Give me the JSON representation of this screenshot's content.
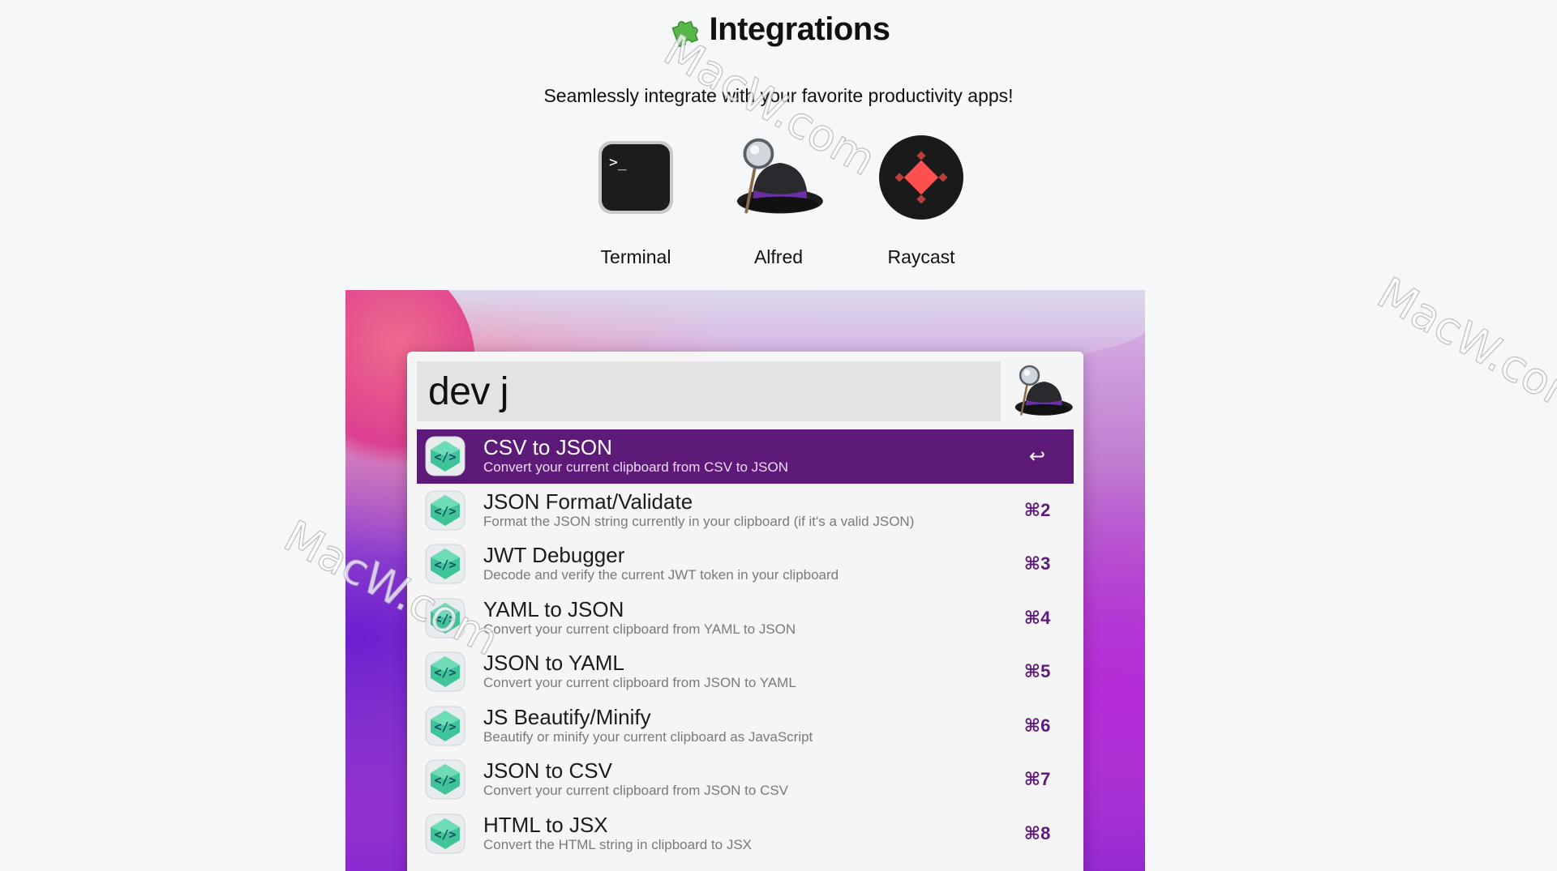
{
  "header": {
    "title": "Integrations",
    "subtitle": "Seamlessly integrate with your favorite productivity apps!",
    "icon": "puzzle-icon"
  },
  "apps": [
    {
      "label": "Terminal",
      "icon": "terminal-icon"
    },
    {
      "label": "Alfred",
      "icon": "alfred-hat-icon"
    },
    {
      "label": "Raycast",
      "icon": "raycast-icon"
    }
  ],
  "alfred": {
    "query": "dev j",
    "results": [
      {
        "title": "CSV to JSON",
        "subtitle": "Convert your current clipboard from CSV to JSON",
        "shortcut": "↩",
        "selected": true
      },
      {
        "title": "JSON Format/Validate",
        "subtitle": "Format the JSON string currently in your clipboard (if it's a valid JSON)",
        "shortcut": "⌘2"
      },
      {
        "title": "JWT Debugger",
        "subtitle": "Decode and verify the current JWT token in your clipboard",
        "shortcut": "⌘3"
      },
      {
        "title": "YAML to JSON",
        "subtitle": "Convert your current clipboard from YAML to JSON",
        "shortcut": "⌘4"
      },
      {
        "title": "JSON to YAML",
        "subtitle": "Convert your current clipboard from JSON to YAML",
        "shortcut": "⌘5"
      },
      {
        "title": "JS Beautify/Minify",
        "subtitle": "Beautify or minify your current clipboard as JavaScript",
        "shortcut": "⌘6"
      },
      {
        "title": "JSON to CSV",
        "subtitle": "Convert your current clipboard from JSON to CSV",
        "shortcut": "⌘7"
      },
      {
        "title": "HTML to JSX",
        "subtitle": "Convert the HTML string in clipboard to JSX",
        "shortcut": "⌘8"
      }
    ]
  },
  "watermark": "MacW.com",
  "colors": {
    "selected_row": "#5d1a78",
    "shortcut": "#5d1a78",
    "page_bg": "#f6f7f9"
  }
}
